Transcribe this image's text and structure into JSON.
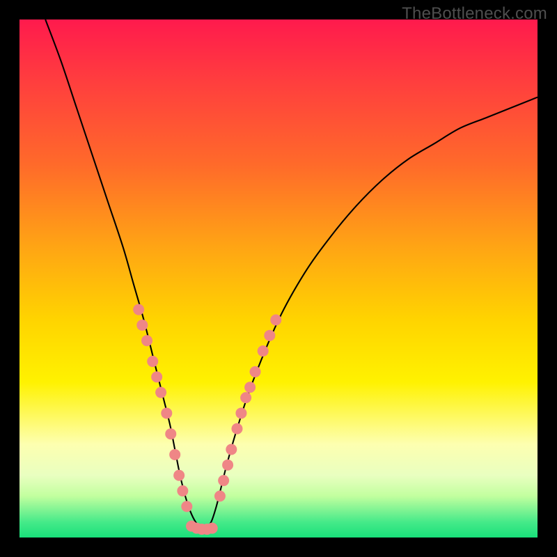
{
  "watermark": "TheBottleneck.com",
  "chart_data": {
    "type": "line",
    "title": "",
    "xlabel": "",
    "ylabel": "",
    "xlim": [
      0,
      100
    ],
    "ylim": [
      0,
      100
    ],
    "grid": false,
    "legend": false,
    "series": [
      {
        "name": "bottleneck-curve",
        "color": "#000000",
        "x": [
          5,
          8,
          11,
          14,
          17,
          20,
          22,
          24,
          26,
          27.5,
          29,
          30,
          31,
          32,
          33,
          34,
          35,
          36,
          37,
          38,
          39,
          40,
          42,
          45,
          50,
          55,
          60,
          65,
          70,
          75,
          80,
          85,
          90,
          95,
          100
        ],
        "y": [
          100,
          92,
          83,
          74,
          65,
          56,
          49,
          42,
          34,
          28,
          22,
          17,
          12,
          8,
          5,
          3,
          2,
          2,
          3,
          6,
          10,
          14,
          21,
          30,
          42,
          51,
          58,
          64,
          69,
          73,
          76,
          79,
          81,
          83,
          85
        ]
      }
    ],
    "markers": [
      {
        "name": "left-markers",
        "color": "#ef8686",
        "points": [
          {
            "x": 23.0,
            "y": 44
          },
          {
            "x": 23.7,
            "y": 41
          },
          {
            "x": 24.6,
            "y": 38
          },
          {
            "x": 25.7,
            "y": 34
          },
          {
            "x": 26.5,
            "y": 31
          },
          {
            "x": 27.3,
            "y": 28
          },
          {
            "x": 28.4,
            "y": 24
          },
          {
            "x": 29.2,
            "y": 20
          },
          {
            "x": 30.0,
            "y": 16
          },
          {
            "x": 30.8,
            "y": 12
          },
          {
            "x": 31.5,
            "y": 9
          },
          {
            "x": 32.3,
            "y": 6
          }
        ]
      },
      {
        "name": "right-markers",
        "color": "#ef8686",
        "points": [
          {
            "x": 38.7,
            "y": 8
          },
          {
            "x": 39.4,
            "y": 11
          },
          {
            "x": 40.2,
            "y": 14
          },
          {
            "x": 40.9,
            "y": 17
          },
          {
            "x": 42.0,
            "y": 21
          },
          {
            "x": 42.8,
            "y": 24
          },
          {
            "x": 43.7,
            "y": 27
          },
          {
            "x": 44.5,
            "y": 29
          },
          {
            "x": 45.5,
            "y": 32
          },
          {
            "x": 47.0,
            "y": 36
          },
          {
            "x": 48.3,
            "y": 39
          },
          {
            "x": 49.5,
            "y": 42
          }
        ]
      },
      {
        "name": "bottom-markers",
        "color": "#ef8686",
        "points": [
          {
            "x": 33.2,
            "y": 2.2
          },
          {
            "x": 34.2,
            "y": 1.8
          },
          {
            "x": 35.2,
            "y": 1.6
          },
          {
            "x": 36.2,
            "y": 1.6
          },
          {
            "x": 37.2,
            "y": 1.8
          }
        ]
      }
    ]
  }
}
